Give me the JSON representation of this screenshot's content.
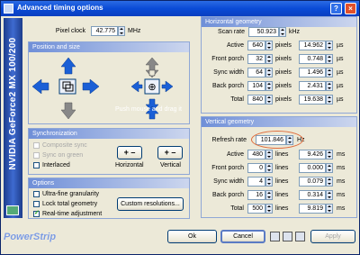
{
  "window": {
    "title": "Advanced timing options"
  },
  "titlebar_buttons": [
    "?",
    "×"
  ],
  "sidebar": {
    "label": "NVIDIA GeForce2 MX 100/200"
  },
  "brand": "PowerStrip",
  "pixel_clock": {
    "label": "Pixel clock",
    "value": "42.775",
    "unit": "MHz"
  },
  "position_size": {
    "header": "Position and size",
    "hint": "Push mouse and drag it"
  },
  "synchronization": {
    "header": "Synchronization",
    "items": [
      {
        "label": "Composite sync",
        "checked": false,
        "enabled": false
      },
      {
        "label": "Sync on green",
        "checked": false,
        "enabled": false
      },
      {
        "label": "Interlaced",
        "checked": false,
        "enabled": true
      }
    ],
    "horizontal": {
      "label": "Horizontal",
      "signs": "+ –"
    },
    "vertical": {
      "label": "Vertical",
      "signs": "+ –"
    }
  },
  "options": {
    "header": "Options",
    "items": [
      {
        "label": "Ultra-fine granularity",
        "checked": false
      },
      {
        "label": "Lock total geometry",
        "checked": false
      },
      {
        "label": "Real-time adjustment",
        "checked": true
      }
    ],
    "custom_button": "Custom resolutions..."
  },
  "horizontal": {
    "header": "Horizontal geometry",
    "scan_rate": {
      "label": "Scan rate",
      "value": "50.923",
      "unit": "kHz"
    },
    "rows": [
      {
        "label": "Active",
        "value": "640",
        "unit": "pixels",
        "time": "14.962",
        "tunit": "µs"
      },
      {
        "label": "Front porch",
        "value": "32",
        "unit": "pixels",
        "time": "0.748",
        "tunit": "µs"
      },
      {
        "label": "Sync width",
        "value": "64",
        "unit": "pixels",
        "time": "1.496",
        "tunit": "µs"
      },
      {
        "label": "Back porch",
        "value": "104",
        "unit": "pixels",
        "time": "2.431",
        "tunit": "µs"
      },
      {
        "label": "Total",
        "value": "840",
        "unit": "pixels",
        "time": "19.638",
        "tunit": "µs"
      }
    ]
  },
  "vertical": {
    "header": "Vertical geometry",
    "refresh": {
      "label": "Refresh rate",
      "value": "101.846",
      "unit": "Hz"
    },
    "rows": [
      {
        "label": "Active",
        "value": "480",
        "unit": "lines",
        "time": "9.426",
        "tunit": "ms"
      },
      {
        "label": "Front porch",
        "value": "0",
        "unit": "lines",
        "time": "0.000",
        "tunit": "ms"
      },
      {
        "label": "Sync width",
        "value": "4",
        "unit": "lines",
        "time": "0.079",
        "tunit": "ms"
      },
      {
        "label": "Back porch",
        "value": "16",
        "unit": "lines",
        "time": "0.314",
        "tunit": "ms"
      },
      {
        "label": "Total",
        "value": "500",
        "unit": "lines",
        "time": "9.819",
        "tunit": "ms"
      }
    ]
  },
  "buttons": {
    "ok": "Ok",
    "cancel": "Cancel",
    "apply": "Apply"
  },
  "colors": {
    "title": "#0a4bd6",
    "accent_arrow": "#1a5fd6",
    "highlight": "#e06b3b"
  }
}
